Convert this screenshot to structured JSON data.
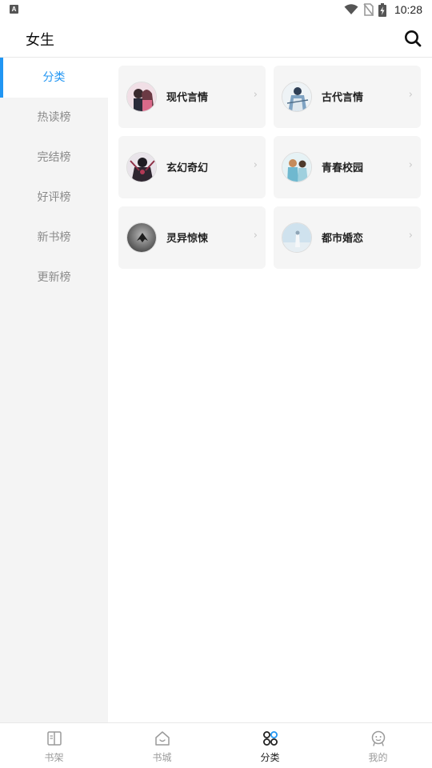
{
  "status_bar": {
    "left_icon": "notification-a-icon",
    "time": "10:28",
    "icons": [
      "wifi-icon",
      "no-sim-icon",
      "battery-charging-icon"
    ]
  },
  "header": {
    "title": "女生",
    "search_icon": "search-icon"
  },
  "sidebar": {
    "items": [
      {
        "label": "分类",
        "active": true
      },
      {
        "label": "热读榜",
        "active": false
      },
      {
        "label": "完结榜",
        "active": false
      },
      {
        "label": "好评榜",
        "active": false
      },
      {
        "label": "新书榜",
        "active": false
      },
      {
        "label": "更新榜",
        "active": false
      }
    ]
  },
  "categories": [
    {
      "label": "现代言情",
      "chevron": "›"
    },
    {
      "label": "古代言情",
      "chevron": "›"
    },
    {
      "label": "玄幻奇幻",
      "chevron": "›"
    },
    {
      "label": "青春校园",
      "chevron": "›"
    },
    {
      "label": "灵异惊悚",
      "chevron": "›"
    },
    {
      "label": "都市婚恋",
      "chevron": "›"
    }
  ],
  "bottom_nav": {
    "items": [
      {
        "label": "书架",
        "icon": "book-open-icon",
        "active": false
      },
      {
        "label": "书城",
        "icon": "house-icon",
        "active": false
      },
      {
        "label": "分类",
        "icon": "category-grid-icon",
        "active": true
      },
      {
        "label": "我的",
        "icon": "profile-face-icon",
        "active": false
      }
    ]
  },
  "colors": {
    "accent": "#2196f3",
    "sidebar_bg": "#f4f4f4",
    "card_bg": "#f5f5f5"
  }
}
